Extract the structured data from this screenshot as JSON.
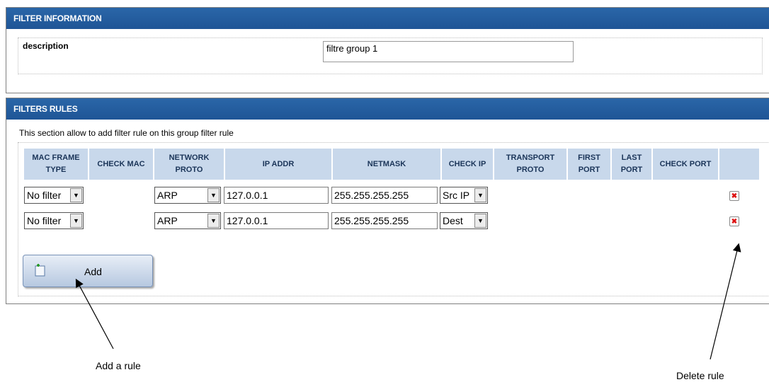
{
  "filter_info": {
    "title": "FILTER INFORMATION",
    "description_label": "description",
    "description_value": "filtre group 1"
  },
  "filter_rules": {
    "title": "FILTERS RULES",
    "description": "This section allow to add filter rule on this group filter rule",
    "columns": [
      {
        "key": "mac_frame_type",
        "label": "MAC FRAME TYPE"
      },
      {
        "key": "check_mac",
        "label": "CHECK MAC"
      },
      {
        "key": "network_proto",
        "label": "NETWORK PROTO"
      },
      {
        "key": "ip_addr",
        "label": "IP ADDR"
      },
      {
        "key": "netmask",
        "label": "NETMASK"
      },
      {
        "key": "check_ip",
        "label": "CHECK IP"
      },
      {
        "key": "transport_proto",
        "label": "TRANSPORT PROTO"
      },
      {
        "key": "first_port",
        "label": "FIRST PORT"
      },
      {
        "key": "last_port",
        "label": "LAST PORT"
      },
      {
        "key": "check_port",
        "label": "CHECK PORT"
      },
      {
        "key": "action",
        "label": ""
      }
    ],
    "rows": [
      {
        "mac_frame_type": "No filter",
        "network_proto": "ARP",
        "ip_addr": "127.0.0.1",
        "netmask": "255.255.255.255",
        "check_ip": "Src IP"
      },
      {
        "mac_frame_type": "No filter",
        "network_proto": "ARP",
        "ip_addr": "127.0.0.1",
        "netmask": "255.255.255.255",
        "check_ip": "Dest"
      }
    ],
    "add_button_label": "Add",
    "delete_icon": "delete-icon"
  },
  "annotations": {
    "add_rule": "Add a rule",
    "delete_rule": "Delete rule"
  },
  "colors": {
    "header_blue": "#1f5596",
    "table_header": "#c8d8eb",
    "delete_red": "#d11111"
  }
}
